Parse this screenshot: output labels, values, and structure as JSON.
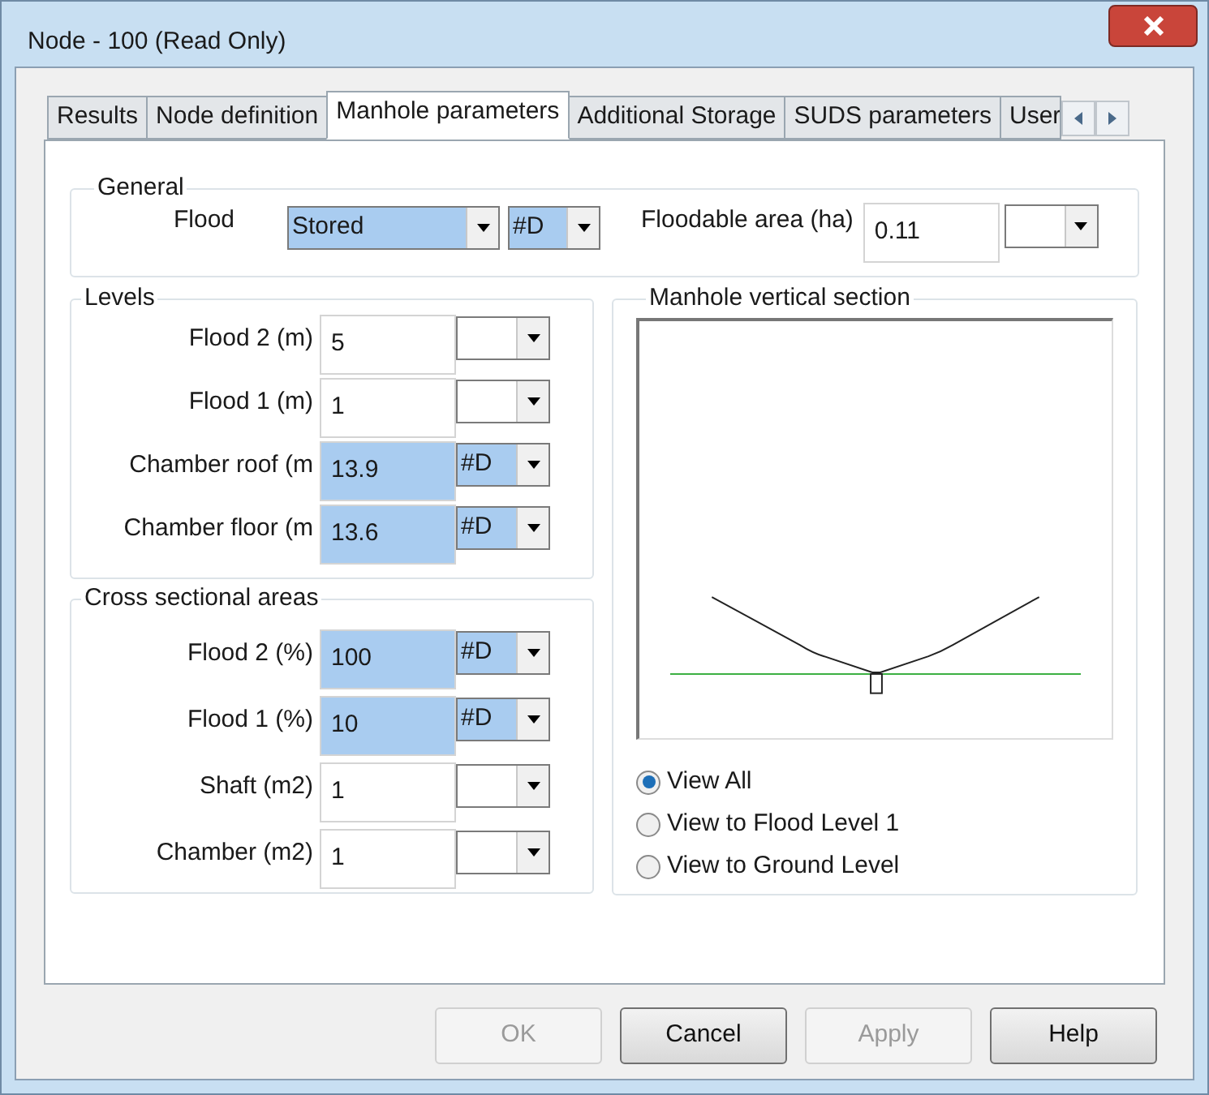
{
  "window": {
    "title": "Node - 100 (Read Only)"
  },
  "tabs": [
    {
      "label": "Results",
      "selected": false
    },
    {
      "label": "Node definition",
      "selected": false
    },
    {
      "label": "Manhole parameters",
      "selected": true
    },
    {
      "label": "Additional Storage",
      "selected": false
    },
    {
      "label": "SUDS parameters",
      "selected": false
    },
    {
      "label": "User",
      "selected": false
    }
  ],
  "general": {
    "title": "General",
    "flood_label": "Flood",
    "flood_value": "Stored",
    "flood_unit": "#D",
    "highlighted": true,
    "area_label": "Floodable area (ha)",
    "area_value": "0.11"
  },
  "levels": {
    "title": "Levels",
    "rows": [
      {
        "label": "Flood 2 (m)",
        "value": "5",
        "highlighted": false
      },
      {
        "label": "Flood 1 (m)",
        "value": "1",
        "highlighted": false
      },
      {
        "label": "Chamber roof (m",
        "value": "13.9",
        "unit": "#D",
        "highlighted": true
      },
      {
        "label": "Chamber floor (m",
        "value": "13.6",
        "unit": "#D",
        "highlighted": true
      }
    ]
  },
  "areas": {
    "title": "Cross sectional areas",
    "rows": [
      {
        "label": "Flood 2 (%)",
        "value": "100",
        "unit": "#D",
        "highlighted": true
      },
      {
        "label": "Flood 1 (%)",
        "value": "10",
        "unit": "#D",
        "highlighted": true
      },
      {
        "label": "Shaft (m2)",
        "value": "1",
        "highlighted": false
      },
      {
        "label": "Chamber (m2)",
        "value": "1",
        "highlighted": false
      }
    ]
  },
  "section": {
    "title": "Manhole vertical section",
    "options": [
      {
        "label": "View All",
        "selected": true
      },
      {
        "label": "View to Flood Level 1",
        "selected": false
      },
      {
        "label": "View to Ground Level",
        "selected": false
      }
    ]
  },
  "buttons": [
    {
      "label": "OK",
      "disabled": true
    },
    {
      "label": "Cancel",
      "disabled": false
    },
    {
      "label": "Apply",
      "disabled": true
    },
    {
      "label": "Help",
      "disabled": false
    }
  ]
}
